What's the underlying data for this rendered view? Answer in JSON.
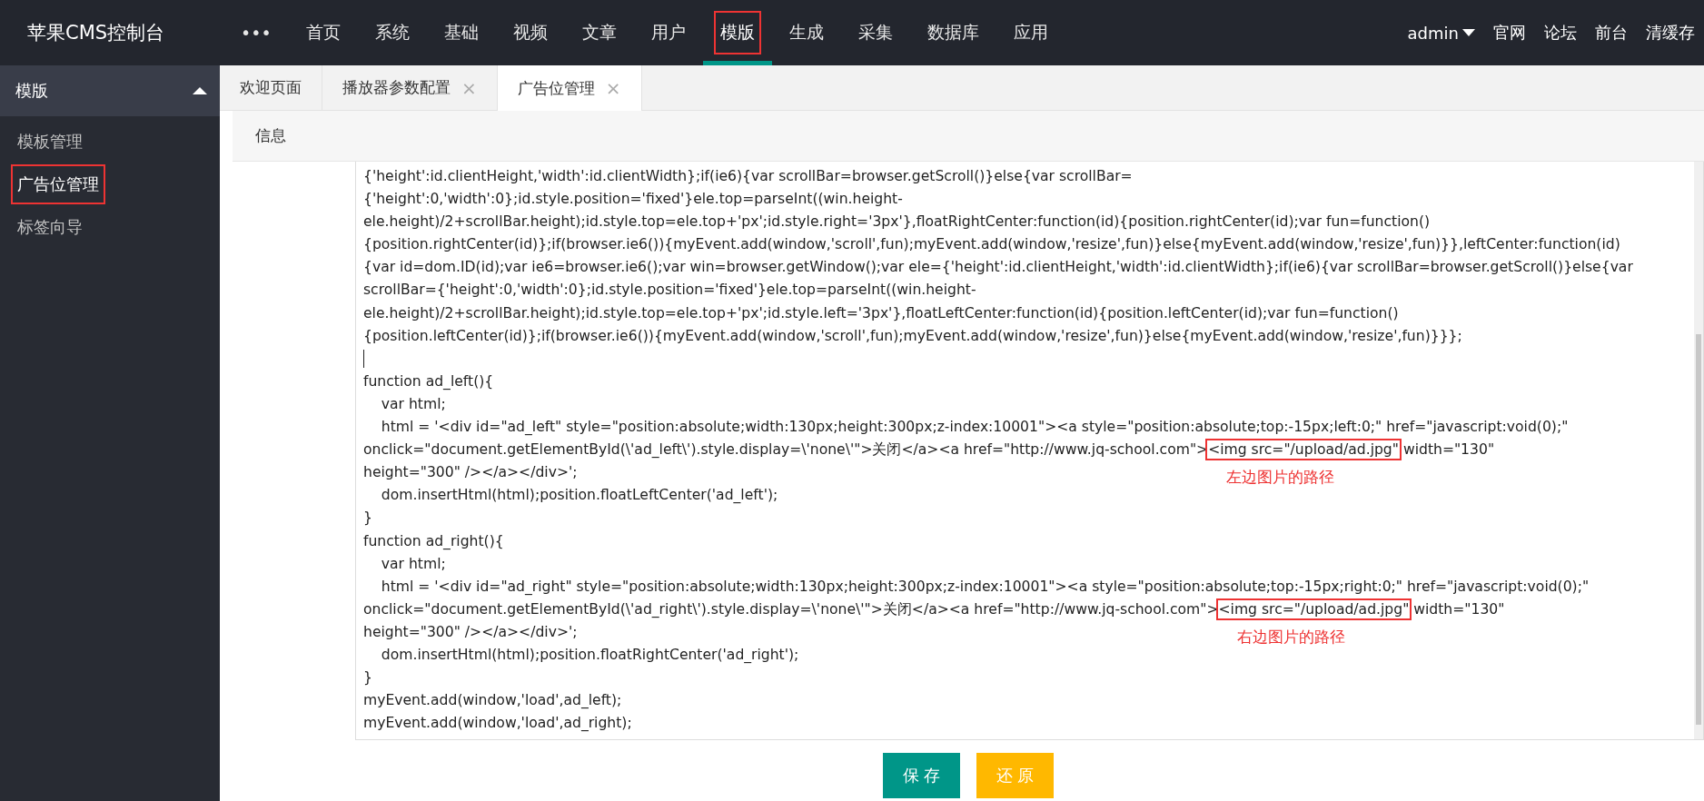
{
  "header": {
    "title": "苹果CMS控制台",
    "nav": [
      {
        "label": "•••",
        "selected": false,
        "highlighted": false
      },
      {
        "label": "首页",
        "selected": false,
        "highlighted": false
      },
      {
        "label": "系统",
        "selected": false,
        "highlighted": false
      },
      {
        "label": "基础",
        "selected": false,
        "highlighted": false
      },
      {
        "label": "视频",
        "selected": false,
        "highlighted": false
      },
      {
        "label": "文章",
        "selected": false,
        "highlighted": false
      },
      {
        "label": "用户",
        "selected": false,
        "highlighted": false
      },
      {
        "label": "模版",
        "selected": true,
        "highlighted": true
      },
      {
        "label": "生成",
        "selected": false,
        "highlighted": false
      },
      {
        "label": "采集",
        "selected": false,
        "highlighted": false
      },
      {
        "label": "数据库",
        "selected": false,
        "highlighted": false
      },
      {
        "label": "应用",
        "selected": false,
        "highlighted": false
      }
    ],
    "user": "admin",
    "links": [
      "官网",
      "论坛",
      "前台",
      "清缓存"
    ]
  },
  "sidebar": {
    "group": {
      "label": "模版",
      "expanded": true
    },
    "items": [
      {
        "label": "模板管理",
        "selected": false,
        "highlighted": false
      },
      {
        "label": "广告位管理",
        "selected": true,
        "highlighted": true
      },
      {
        "label": "标签向导",
        "selected": false,
        "highlighted": false
      }
    ]
  },
  "tabs": [
    {
      "label": "欢迎页面",
      "selected": false
    },
    {
      "label": "播放器参数配置",
      "selected": false,
      "close": "×"
    },
    {
      "label": "广告位管理",
      "selected": true,
      "close": "×"
    }
  ],
  "section_title": "信息",
  "code_lines": [
    {
      "text": "{'height':id.clientHeight,'width':id.clientWidth};if(ie6){var scrollBar=browser.getScroll()}else{var scrollBar="
    },
    {
      "text": "{'height':0,'width':0};id.style.position='fixed'}ele.top=parseInt((win.height-"
    },
    {
      "text": "ele.height)/2+scrollBar.height);id.style.top=ele.top+'px';id.style.right='3px'},floatRightCenter:function(id){position.rightCenter(id);var fun=function()"
    },
    {
      "text": "{position.rightCenter(id)};if(browser.ie6()){myEvent.add(window,'scroll',fun);myEvent.add(window,'resize',fun)}else{myEvent.add(window,'resize',fun)}},leftCenter:function(id)"
    },
    {
      "text": "{var id=dom.ID(id);var ie6=browser.ie6();var win=browser.getWindow();var ele={'height':id.clientHeight,'width':id.clientWidth};if(ie6){var scrollBar=browser.getScroll()}else{var"
    },
    {
      "text": "scrollBar={'height':0,'width':0};id.style.position='fixed'}ele.top=parseInt((win.height-"
    },
    {
      "text": "ele.height)/2+scrollBar.height);id.style.top=ele.top+'px';id.style.left='3px'},floatLeftCenter:function(id){position.leftCenter(id);var fun=function()"
    },
    {
      "text": "{position.leftCenter(id)};if(browser.ie6()){myEvent.add(window,'scroll',fun);myEvent.add(window,'resize',fun)}else{myEvent.add(window,'resize',fun)}}};"
    },
    {
      "cursor": true
    },
    {
      "text": "function ad_left(){"
    },
    {
      "text": "    var html;"
    },
    {
      "text": "    html = '<div id=\"ad_left\" style=\"position:absolute;width:130px;height:300px;z-index:10001\"><a style=\"position:absolute;top:-15px;left:0;\" href=\"javascript:void(0);\""
    },
    {
      "text": "onclick=\"document.getElementById(\\'ad_left\\').style.display=\\'none\\'\">关闭</a><a href=\"http://www.jq-school.com\">",
      "boxed": "<img src=\"/upload/ad.jpg\"",
      "after": " width=\"130\"",
      "note": "左边图片的路径"
    },
    {
      "text": "height=\"300\" /></a></div>';"
    },
    {
      "text": "    dom.insertHtml(html);position.floatLeftCenter('ad_left');"
    },
    {
      "text": "}"
    },
    {
      "text": "function ad_right(){"
    },
    {
      "text": "    var html;"
    },
    {
      "text": "    html = '<div id=\"ad_right\" style=\"position:absolute;width:130px;height:300px;z-index:10001\"><a style=\"position:absolute;top:-15px;right:0;\" href=\"javascript:void(0);\""
    },
    {
      "text": "onclick=\"document.getElementById(\\'ad_right\\').style.display=\\'none\\'\">关闭</a><a href=\"http://www.jq-school.com\">",
      "boxed": "<img src=\"/upload/ad.jpg\"",
      "after": " width=\"130\"",
      "note": "右边图片的路径"
    },
    {
      "text": "height=\"300\" /></a></div>';"
    },
    {
      "text": "    dom.insertHtml(html);position.floatRightCenter('ad_right');"
    },
    {
      "text": "}"
    },
    {
      "text": "myEvent.add(window,'load',ad_left);"
    },
    {
      "text": "myEvent.add(window,'load',ad_right);"
    }
  ],
  "buttons": [
    {
      "label": "保 存",
      "kind": "primary"
    },
    {
      "label": "还 原",
      "kind": "warning"
    }
  ]
}
